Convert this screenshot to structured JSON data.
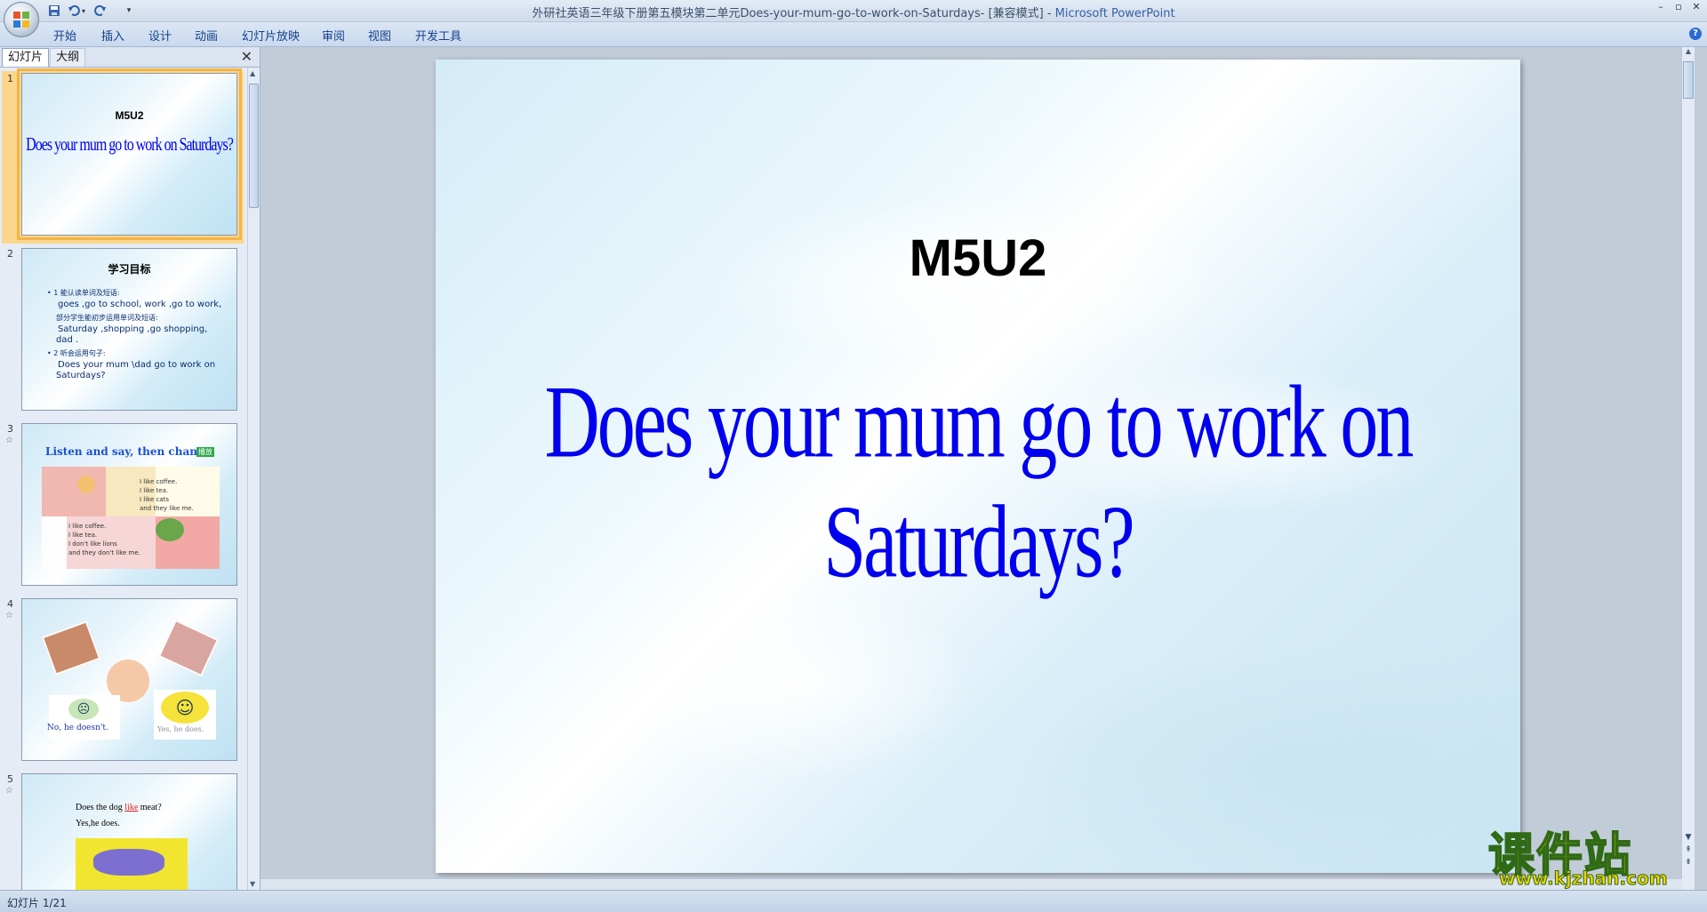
{
  "window": {
    "title": "外研社英语三年级下册第五模块第二单元Does-your-mum-go-to-work-on-Saturdays- [兼容模式] - ",
    "app_name": "Microsoft PowerPoint",
    "controls": {
      "minimize": "–",
      "restore": "▫",
      "close": "✕"
    }
  },
  "ribbon": {
    "tabs": [
      "开始",
      "插入",
      "设计",
      "动画",
      "幻灯片放映",
      "审阅",
      "视图",
      "开发工具"
    ],
    "help": "?"
  },
  "panel": {
    "tab_slides": "幻灯片",
    "tab_outline": "大纲",
    "close": "✕"
  },
  "thumbnails": [
    {
      "num": "1",
      "code": "M5U2",
      "title": "Does your mum go to work on Saturdays?"
    },
    {
      "num": "2",
      "heading": "学习目标",
      "lines": [
        "• 1 能认读单词及短语:",
        "goes ,go to school, work ,go to work,",
        "部分学生能初步运用单词及短语:",
        "Saturday ,shopping ,go shopping,",
        "dad .",
        "• 2 听会运用句子:",
        "Does your mum \\dad go to work on",
        "Saturdays?"
      ]
    },
    {
      "num": "3",
      "heading": "Listen and say,  then chant.",
      "badge": "播放",
      "lines_a": [
        "I like coffee.",
        "I like tea.",
        "I like cats",
        "and they like me."
      ],
      "lines_b": [
        "I like coffee.",
        "I like tea.",
        "I don't like lions",
        "and they don't like me."
      ]
    },
    {
      "num": "4",
      "no": "No,  he doesn't.",
      "yes": "Yes, he does."
    },
    {
      "num": "5",
      "q_pre": "Does the dog ",
      "q_word": "like",
      "q_post": " meat?",
      "a": "Yes,he does."
    }
  ],
  "slide": {
    "code": "M5U2",
    "title": "Does your mum go to work on Saturdays?"
  },
  "watermark": {
    "cn": "课件站",
    "url": "www.kjzhan.com"
  },
  "status": {
    "text": "幻灯片 1/21"
  }
}
